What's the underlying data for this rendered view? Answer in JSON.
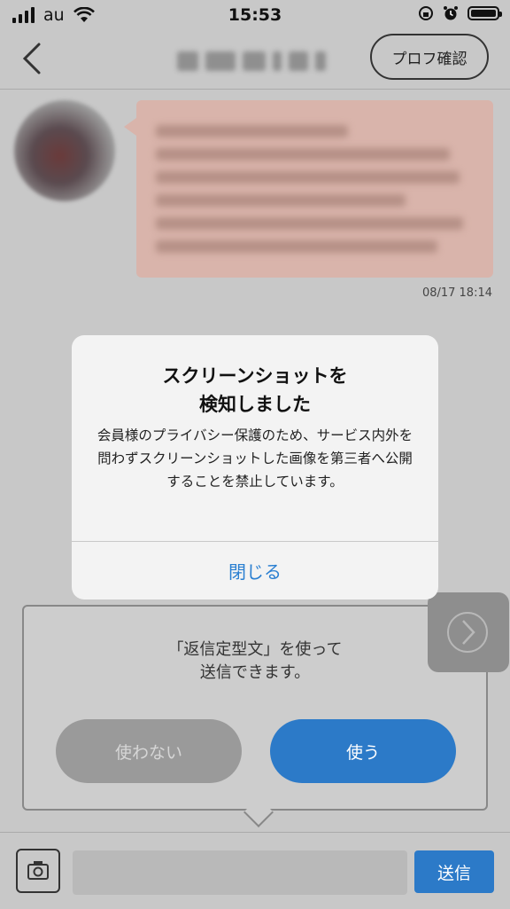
{
  "status_bar": {
    "carrier": "au",
    "time": "15:53"
  },
  "nav": {
    "profile_button": "プロフ確認"
  },
  "chat": {
    "timestamp": "08/17 18:14"
  },
  "alert": {
    "title": "スクリーンショットを\n検知しました",
    "message": "会員様のプライバシー保護のため、サービス内外を問わずスクリーンショットした画像を第三者へ公開することを禁止しています。",
    "close_label": "閉じる"
  },
  "template_prompt": {
    "line1": "「返信定型文」を使って",
    "line2": "送信できます。",
    "decline_label": "使わない",
    "accept_label": "使う"
  },
  "composer": {
    "send_label": "送信",
    "input_value": ""
  },
  "colors": {
    "accent": "#2c7ac8",
    "alert_button": "#2a7fd1",
    "bubble": "#d9b4ab"
  }
}
